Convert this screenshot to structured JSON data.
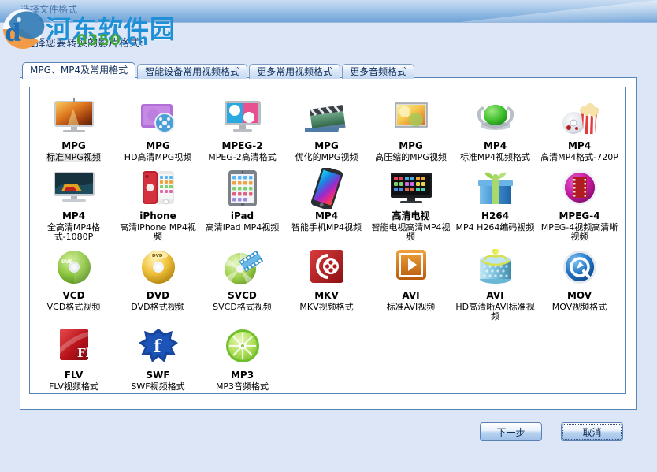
{
  "window": {
    "title": "选择文件格式",
    "instruction": "请选择您要转换的影片格式:"
  },
  "watermark": {
    "site_name": "河东软件园",
    "url_main": "0350",
    "url_tld": ".cn"
  },
  "tabs": [
    {
      "label": "MPG、MP4及常用格式",
      "active": true
    },
    {
      "label": "智能设备常用视频格式",
      "active": false
    },
    {
      "label": "更多常用视频格式",
      "active": false
    },
    {
      "label": "更多音频格式",
      "active": false
    }
  ],
  "formats": [
    [
      {
        "icon": "tv-mpg-icon",
        "code": "MPG",
        "desc": "标准MPG视频",
        "selected": true
      },
      {
        "icon": "purple-folder-icon",
        "code": "MPG",
        "desc": "HD高清MPG视频",
        "selected": false
      },
      {
        "icon": "monitor-mpeg2-icon",
        "code": "MPEG-2",
        "desc": "MPEG-2高清格式",
        "selected": false
      },
      {
        "icon": "clapboard-icon",
        "code": "MPG",
        "desc": "优化的MPG视频",
        "selected": false
      },
      {
        "icon": "picture-frame-icon",
        "code": "MPG",
        "desc": "高压缩的MPG视频",
        "selected": false
      },
      {
        "icon": "green-speaker-icon",
        "code": "MP4",
        "desc": "标准MP4视频格式",
        "selected": false
      },
      {
        "icon": "popcorn-disc-icon",
        "code": "MP4",
        "desc": "高清MP4格式-720P",
        "selected": false
      }
    ],
    [
      {
        "icon": "widescreen-tv-icon",
        "code": "MP4",
        "desc": "全高清MP4格式-1080P",
        "selected": false
      },
      {
        "icon": "iphone-icon",
        "code": "iPhone",
        "desc": "高清iPhone MP4视频",
        "selected": false
      },
      {
        "icon": "ipad-icon",
        "code": "iPad",
        "desc": "高清iPad MP4视频",
        "selected": false
      },
      {
        "icon": "smartphone-icon",
        "code": "MP4",
        "desc": "智能手机MP4视频",
        "selected": false
      },
      {
        "icon": "smart-tv-icon",
        "code": "高清电视",
        "desc": "智能电视高清MP4视频",
        "selected": false
      },
      {
        "icon": "giftbox-blue-icon",
        "code": "H264",
        "desc": "MP4 H264编码视频",
        "selected": false
      },
      {
        "icon": "filmreel-circle-icon",
        "code": "MPEG-4",
        "desc": "MPEG-4视频高清晰视频",
        "selected": false
      }
    ],
    [
      {
        "icon": "green-disc-icon",
        "code": "VCD",
        "desc": "VCD格式视频",
        "selected": false
      },
      {
        "icon": "gold-disc-icon",
        "code": "DVD",
        "desc": "DVD格式视频",
        "selected": false
      },
      {
        "icon": "svcd-disc-icon",
        "code": "SVCD",
        "desc": "SVCD格式视频",
        "selected": false
      },
      {
        "icon": "mkv-red-icon",
        "code": "MKV",
        "desc": "MKV视频格式",
        "selected": false
      },
      {
        "icon": "avi-orange-icon",
        "code": "AVI",
        "desc": "标准AVI视频",
        "selected": false
      },
      {
        "icon": "avi-giftbox-icon",
        "code": "AVI",
        "desc": "HD高清晰AVI标准视频",
        "selected": false
      },
      {
        "icon": "quicktime-mov-icon",
        "code": "MOV",
        "desc": "MOV视频格式",
        "selected": false
      }
    ],
    [
      {
        "icon": "flash-flv-icon",
        "code": "FLV",
        "desc": "FLV视频格式",
        "selected": false
      },
      {
        "icon": "flash-swf-icon",
        "code": "SWF",
        "desc": "SWF视频格式",
        "selected": false
      },
      {
        "icon": "lime-mp3-icon",
        "code": "MP3",
        "desc": "MP3音频格式",
        "selected": false
      }
    ]
  ],
  "buttons": {
    "next": "下一步",
    "cancel": "取消"
  },
  "colors": {
    "window_bg": "#dde6f7",
    "panel_border": "#5585b5",
    "title_text": "#15386b",
    "watermark_blue": "#1f8fd6",
    "watermark_green": "#3fa832"
  }
}
